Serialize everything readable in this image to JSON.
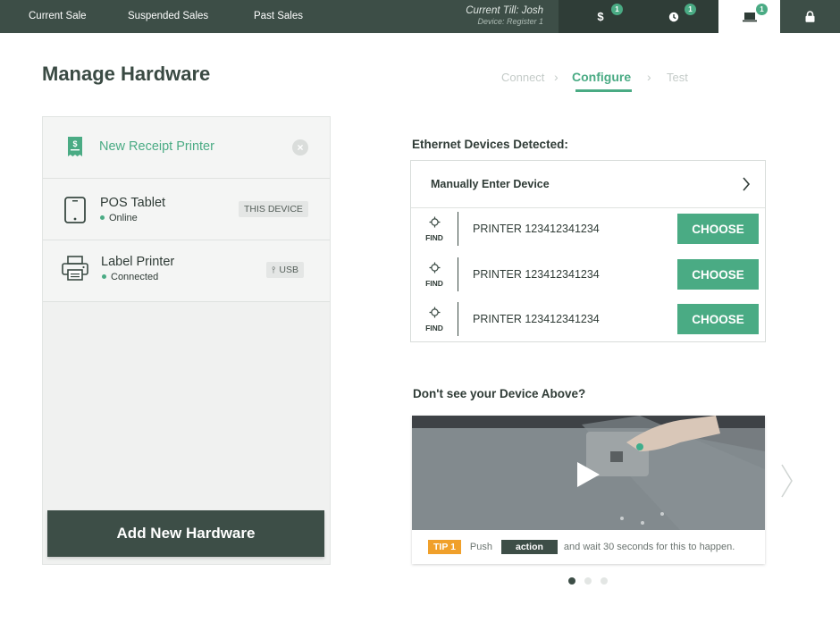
{
  "nav": {
    "tabs": [
      "Current Sale",
      "Suspended Sales",
      "Past Sales"
    ],
    "till_user": "Current Till: Josh",
    "till_device": "Device: Register 1",
    "icons": [
      {
        "name": "dollar-icon",
        "badge": "1"
      },
      {
        "name": "clock-icon",
        "badge": "1"
      },
      {
        "name": "laptop-icon",
        "badge": "1",
        "active": true
      },
      {
        "name": "lock-icon"
      }
    ]
  },
  "page": {
    "title": "Manage Hardware",
    "steps": [
      "Connect",
      "Configure",
      "Test"
    ],
    "active_step": "Configure"
  },
  "hardware": {
    "new_item": "New Receipt Printer",
    "devices": [
      {
        "name": "POS Tablet",
        "status": "Online",
        "tag": "THIS DEVICE",
        "icon": "tablet-icon"
      },
      {
        "name": "Label Printer",
        "status": "Connected",
        "tag": "USB",
        "icon": "printer-icon"
      }
    ],
    "add_button": "Add New Hardware"
  },
  "ethernet": {
    "title": "Ethernet Devices Detected:",
    "manual_label": "Manually Enter Device",
    "find_label": "FIND",
    "choose_label": "CHOOSE",
    "devices": [
      "PRINTER 123412341234",
      "PRINTER 123412341234",
      "PRINTER 123412341234"
    ]
  },
  "help": {
    "title": "Don't see your Device Above?",
    "tip_label": "TIP",
    "tip_number": "1",
    "tip_prefix": "Push",
    "tip_action": "action",
    "tip_suffix": "and wait 30 seconds for this to happen."
  },
  "carousel": {
    "pages": 3,
    "current": 1
  },
  "colors": {
    "accent": "#4aab84",
    "dark": "#3d4e47",
    "tip": "#f0a02b"
  }
}
